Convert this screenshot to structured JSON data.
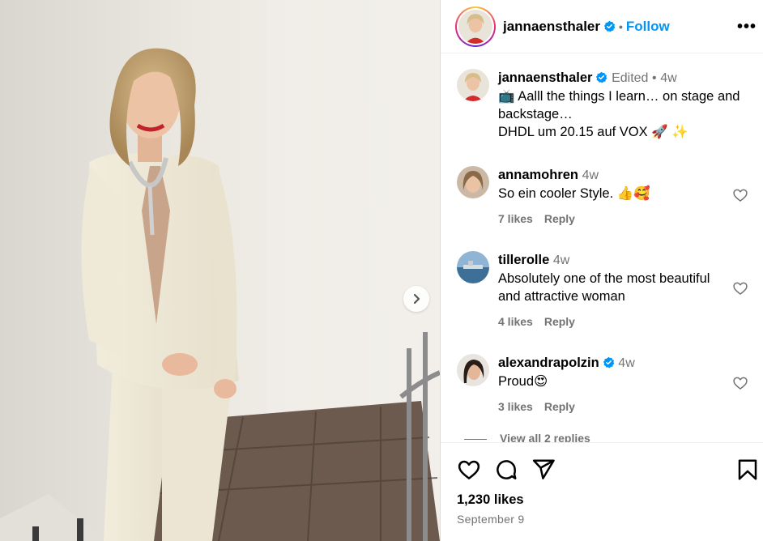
{
  "post": {
    "author": "jannaensthaler",
    "follow_label": "Follow",
    "more_label": "•••",
    "caption_user": "jannaensthaler",
    "caption_edited": "Edited",
    "caption_time": "4w",
    "caption_line1": "📺 Aalll the things I learn… on stage and backstage…",
    "caption_line2": "DHDL um 20.15 auf VOX 🚀 ✨",
    "likes": "1,230 likes",
    "date": "September 9"
  },
  "comments": [
    {
      "user": "annamohren",
      "time": "4w",
      "verified": false,
      "text": "So ein cooler Style. 👍🥰",
      "likes": "7 likes",
      "reply": "Reply"
    },
    {
      "user": "tillerolle",
      "time": "4w",
      "verified": false,
      "text": "Absolutely one of the most beautiful and attractive woman",
      "likes": "4 likes",
      "reply": "Reply"
    },
    {
      "user": "alexandrapolzin",
      "time": "4w",
      "verified": true,
      "text": "Proud😍",
      "likes": "3 likes",
      "reply": "Reply"
    }
  ],
  "view_replies": "View all 2 replies",
  "colors": {
    "accent": "#0095f6",
    "verified": "#0095f6",
    "muted": "#737373"
  },
  "icons": [
    "heart-icon",
    "comment-icon",
    "share-icon",
    "bookmark-icon",
    "chevron-right-icon",
    "more-icon",
    "verified-icon"
  ]
}
